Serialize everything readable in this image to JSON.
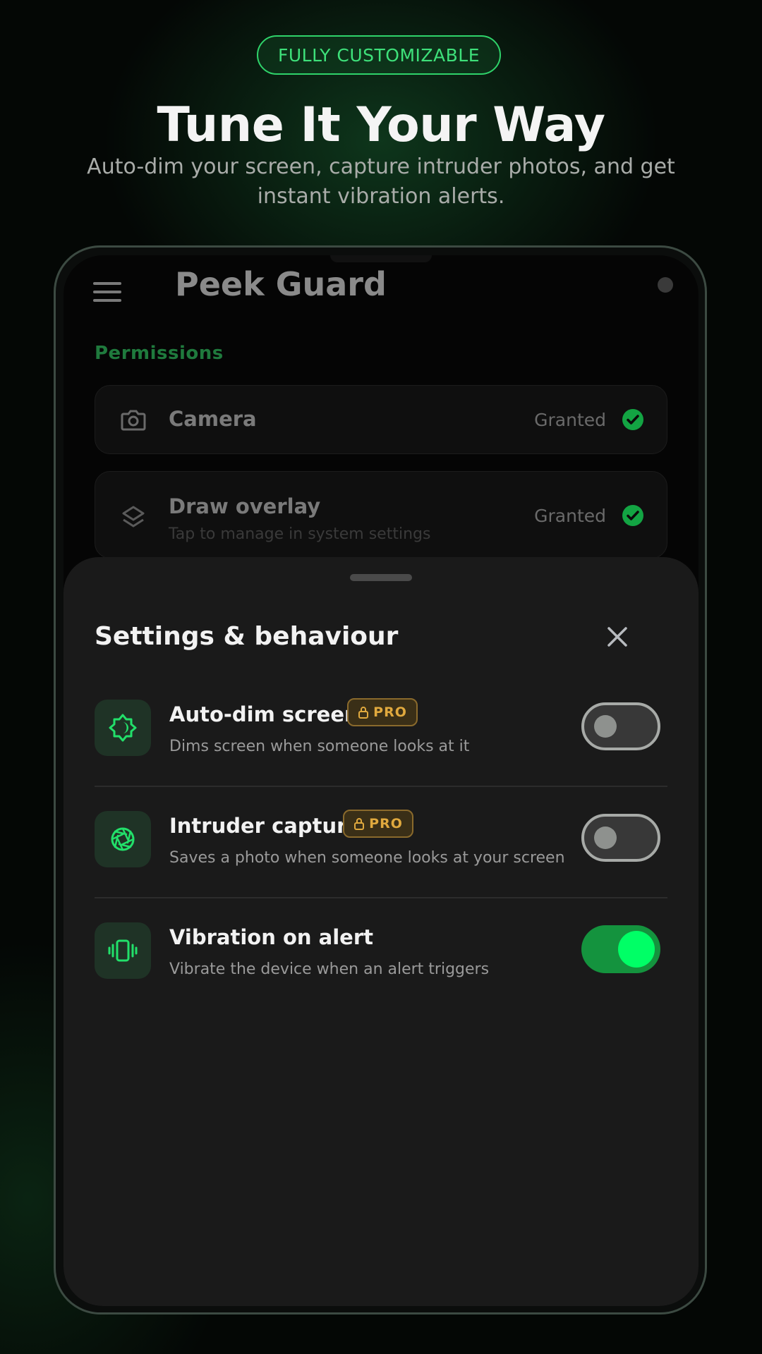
{
  "promo": {
    "badge": "FULLY CUSTOMIZABLE",
    "title": "Tune It Your Way",
    "subtitle": "Auto-dim your screen, capture intruder photos, and get instant vibration alerts."
  },
  "app": {
    "title": "Peek Guard",
    "section_label": "Permissions",
    "permissions": [
      {
        "name": "Camera",
        "hint": "",
        "status": "Granted",
        "icon": "camera-icon"
      },
      {
        "name": "Draw overlay",
        "hint": "Tap to manage in system settings",
        "status": "Granted",
        "icon": "layers-icon"
      }
    ]
  },
  "sheet": {
    "title": "Settings & behaviour",
    "pro_label": "PRO",
    "settings": [
      {
        "title": "Auto-dim screen",
        "desc": "Dims screen when someone looks at it",
        "pro": true,
        "enabled": false,
        "icon": "brightness-icon"
      },
      {
        "title": "Intruder capture",
        "desc": "Saves a photo when someone looks at your screen",
        "pro": true,
        "enabled": false,
        "icon": "aperture-icon"
      },
      {
        "title": "Vibration on alert",
        "desc": "Vibrate the device when an alert triggers",
        "pro": false,
        "enabled": true,
        "icon": "vibration-icon"
      }
    ]
  },
  "colors": {
    "accent": "#00ff66",
    "badge_border": "#2fd36a",
    "pro_text": "#e0a93e",
    "check": "#13a443"
  }
}
